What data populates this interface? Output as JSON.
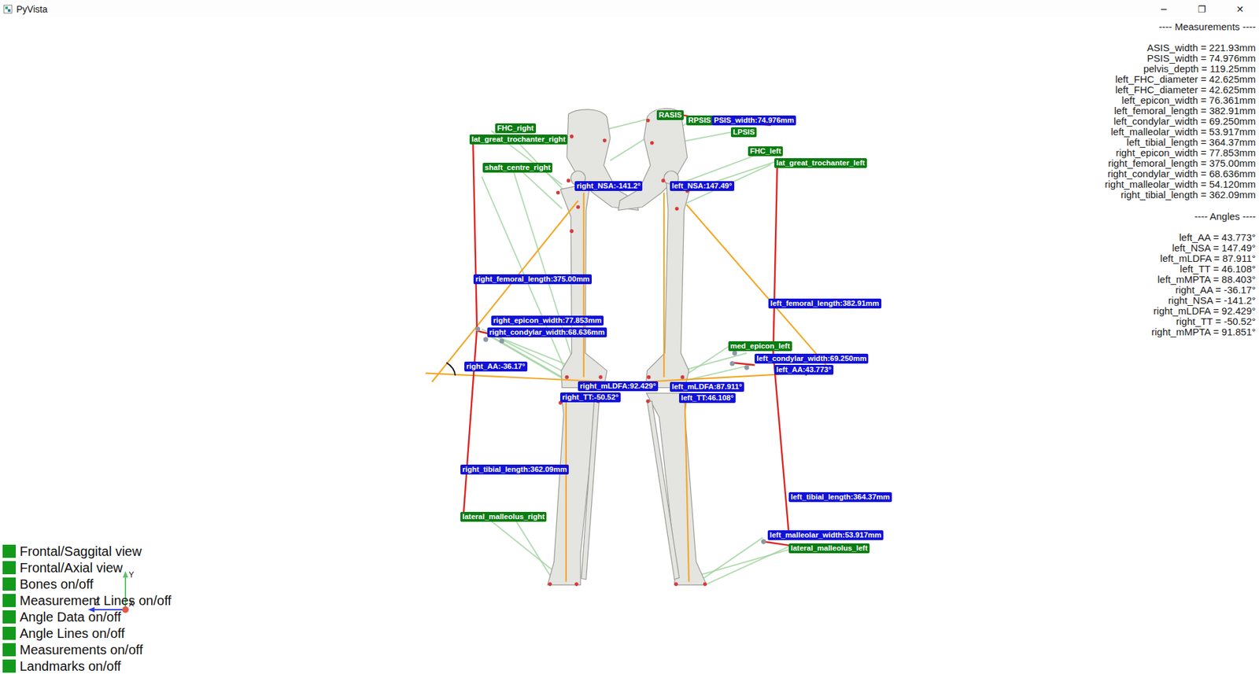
{
  "window": {
    "title": "PyVista",
    "controls": [
      "─",
      "❐",
      "✕"
    ]
  },
  "measurements_panel": {
    "heading": "---- Measurements ----",
    "items": [
      "ASIS_width = 221.93mm",
      "PSIS_width = 74.976mm",
      "pelvis_depth = 119.25mm",
      "left_FHC_diameter = 42.625mm",
      "left_FHC_diameter = 42.625mm",
      "left_epicon_width = 76.361mm",
      "left_femoral_length = 382.91mm",
      "left_condylar_width = 69.250mm",
      "left_malleolar_width = 53.917mm",
      "left_tibial_length = 364.37mm",
      "right_epicon_width = 77.853mm",
      "right_femoral_length = 375.00mm",
      "right_condylar_width = 68.636mm",
      "right_malleolar_width = 54.120mm",
      "right_tibial_length = 362.09mm"
    ]
  },
  "angles_panel": {
    "heading": "---- Angles ----",
    "items": [
      "left_AA = 43.773°",
      "left_NSA = 147.49°",
      "left_mLDFA = 87.911°",
      "left_TT = 46.108°",
      "left_mMPTA = 88.403°",
      "right_AA = -36.17°",
      "right_NSA = -141.2°",
      "right_mLDFA = 92.429°",
      "right_TT = -50.52°",
      "right_mMPTA = 91.851°"
    ]
  },
  "scene_labels": [
    {
      "text": "FHC_right",
      "kind": "landmark"
    },
    {
      "text": "lat_great_trochanter_right",
      "kind": "landmark"
    },
    {
      "text": "shaft_centre_right",
      "kind": "landmark"
    },
    {
      "text": "RASIS",
      "kind": "landmark"
    },
    {
      "text": "RPSIS",
      "kind": "landmark"
    },
    {
      "text": "LPSIS",
      "kind": "landmark"
    },
    {
      "text": "FHC_left",
      "kind": "landmark"
    },
    {
      "text": "lat_great_trochanter_left",
      "kind": "landmark"
    },
    {
      "text": "med_epicon_left",
      "kind": "landmark"
    },
    {
      "text": "lateral_malleolus_right",
      "kind": "landmark"
    },
    {
      "text": "lateral_malleolus_left",
      "kind": "landmark"
    },
    {
      "text": "PSIS_width:74.976mm",
      "kind": "measurement"
    },
    {
      "text": "right_NSA:-141.2°",
      "kind": "measurement"
    },
    {
      "text": "left_NSA:147.49°",
      "kind": "measurement"
    },
    {
      "text": "right_femoral_length:375.00mm",
      "kind": "measurement"
    },
    {
      "text": "left_femoral_length:382.91mm",
      "kind": "measurement"
    },
    {
      "text": "right_epicon_width:77.853mm",
      "kind": "measurement"
    },
    {
      "text": "right_condylar_width:68.636mm",
      "kind": "measurement"
    },
    {
      "text": "left_condylar_width:69.250mm",
      "kind": "measurement"
    },
    {
      "text": "left_AA:43.773°",
      "kind": "measurement"
    },
    {
      "text": "right_AA:-36.17°",
      "kind": "measurement"
    },
    {
      "text": "right_mLDFA:92.429°",
      "kind": "measurement"
    },
    {
      "text": "left_mLDFA:87.911°",
      "kind": "measurement"
    },
    {
      "text": "right_TT:-50.52°",
      "kind": "measurement"
    },
    {
      "text": "left_TT:46.108°",
      "kind": "measurement"
    },
    {
      "text": "right_tibial_length:362.09mm",
      "kind": "measurement"
    },
    {
      "text": "left_tibial_length:364.37mm",
      "kind": "measurement"
    },
    {
      "text": "left_malleolar_width:53.917mm",
      "kind": "measurement"
    }
  ],
  "axes": {
    "labels": [
      "Y",
      "Z",
      "X"
    ]
  },
  "buttons": [
    {
      "label": "Frontal/Saggital view",
      "on": true
    },
    {
      "label": "Frontal/Axial view",
      "on": true
    },
    {
      "label": "Bones on/off",
      "on": true
    },
    {
      "label": "Measurement Lines on/off",
      "on": true
    },
    {
      "label": "Angle Data on/off",
      "on": true
    },
    {
      "label": "Angle Lines on/off",
      "on": true
    },
    {
      "label": "Measurements on/off",
      "on": true
    },
    {
      "label": "Landmarks on/off",
      "on": true
    }
  ]
}
